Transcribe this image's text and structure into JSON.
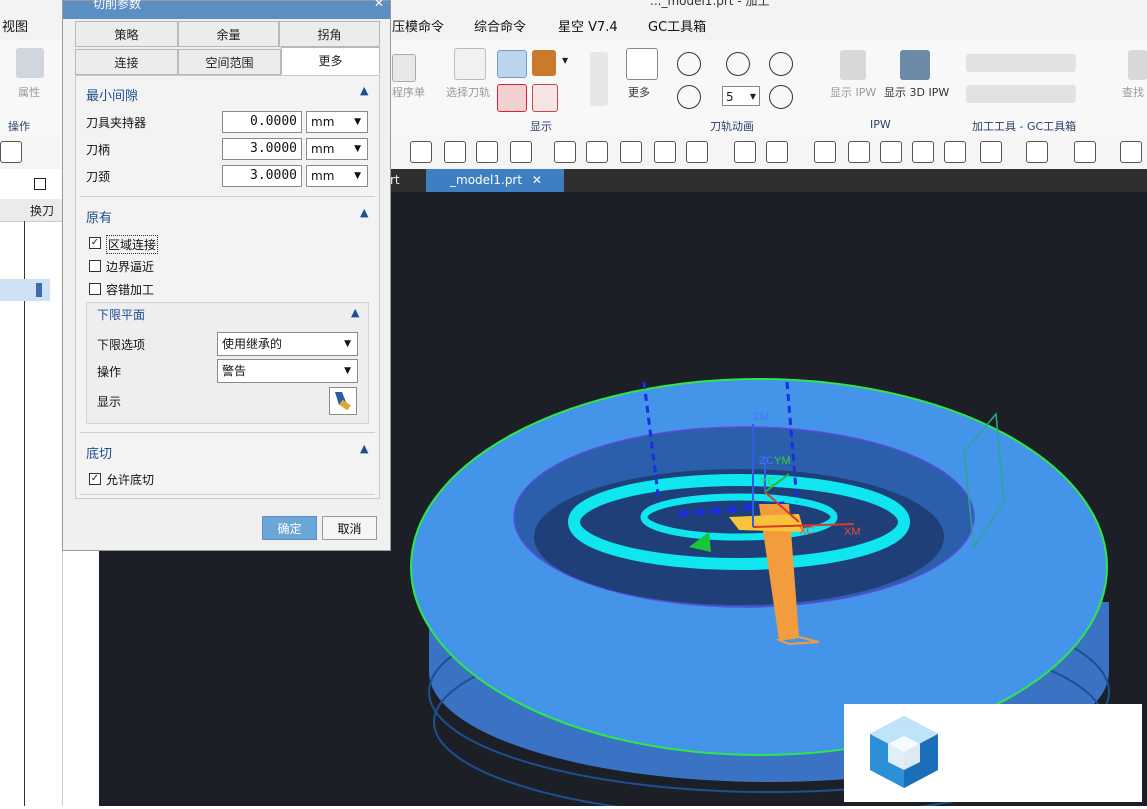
{
  "menu": {
    "items": [
      "视图",
      "压模命令",
      "综合命令",
      "星空 V7.4",
      "GC工具箱"
    ],
    "title_fragment": "..._model1.prt - 加工"
  },
  "ribbon": {
    "left_group": {
      "button": "属性",
      "label": "操作"
    },
    "buttons": {
      "program_order": "程序单",
      "select_toolpath": "选择刀轨",
      "more": "更多",
      "show_ipw": "显示 IPW",
      "show_3d_ipw": "显示 3D IPW",
      "find": "查找"
    },
    "groups": {
      "display": "显示",
      "animation": "刀轨动画",
      "ipw": "IPW",
      "gc": "加工工具 - GC工具箱"
    },
    "speed_value": "5"
  },
  "tabs": {
    "prev_fragment": "rt",
    "active": "_model1.prt"
  },
  "navigator": {
    "column_header": "换刀"
  },
  "dialog": {
    "title": "切削参数",
    "tabs_row1": [
      "策略",
      "余量",
      "拐角"
    ],
    "tabs_row2": [
      "连接",
      "空间范围",
      "更多"
    ],
    "active_tab": "更多",
    "sections": {
      "min_clearance": {
        "title": "最小间隙",
        "fields": [
          {
            "label": "刀具夹持器",
            "value": "0.0000",
            "unit": "mm"
          },
          {
            "label": "刀柄",
            "value": "3.0000",
            "unit": "mm"
          },
          {
            "label": "刀颈",
            "value": "3.0000",
            "unit": "mm"
          }
        ]
      },
      "legacy": {
        "title": "原有",
        "checks": [
          {
            "label": "区域连接",
            "checked": true
          },
          {
            "label": "边界逼近",
            "checked": false
          },
          {
            "label": "容错加工",
            "checked": false
          }
        ],
        "lower_plane": {
          "title": "下限平面",
          "option_label": "下限选项",
          "option_value": "使用继承的",
          "operation_label": "操作",
          "operation_value": "警告",
          "display_label": "显示"
        }
      },
      "undercut": {
        "title": "底切",
        "check": {
          "label": "允许底切",
          "checked": true
        }
      }
    },
    "buttons": {
      "ok": "确定",
      "cancel": "取消"
    }
  },
  "viewport": {
    "axis_labels": {
      "zm": "ZM",
      "zc": "ZC",
      "ym": "YM",
      "yc": "YC",
      "xc": "XC",
      "xm": "XM"
    }
  },
  "colors": {
    "part": "#3f86e0",
    "edge_highlight": "#2ee84a",
    "toolpath": "#10e6f0",
    "tool": "#f39c3d",
    "background": "#1c1f26",
    "dialog_section": "#1d4d8f",
    "accent": "#3d7fc1"
  }
}
